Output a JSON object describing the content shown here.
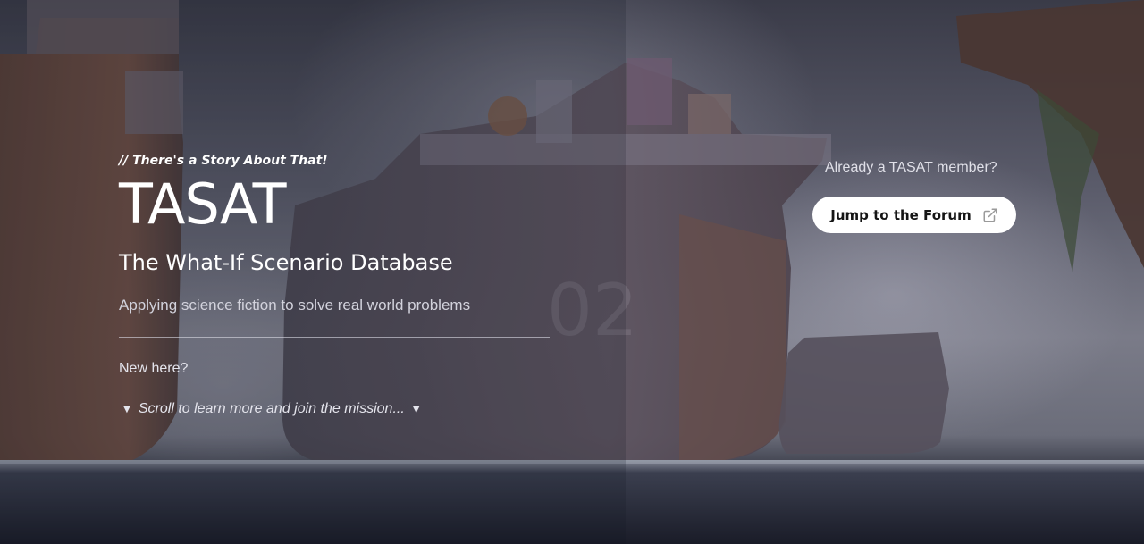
{
  "hero": {
    "eyebrow": "// There's a Story About That!",
    "title": "TASAT",
    "subtitle": "The What-If Scenario Database",
    "tagline": "Applying science fiction to solve real world problems",
    "new_here": "New here?",
    "scroll_cta": {
      "arrow_left": "▼",
      "text": "Scroll to learn more and join the mission...",
      "arrow_right": "▼"
    }
  },
  "member_panel": {
    "prompt": "Already a TASAT member?",
    "forum_button": {
      "label": "Jump to the Forum",
      "icon": "external-link-icon"
    }
  },
  "colors": {
    "button_bg": "#ffffff",
    "button_text": "#151515",
    "text_primary": "#ffffff",
    "text_muted": "#d2d2dc"
  }
}
